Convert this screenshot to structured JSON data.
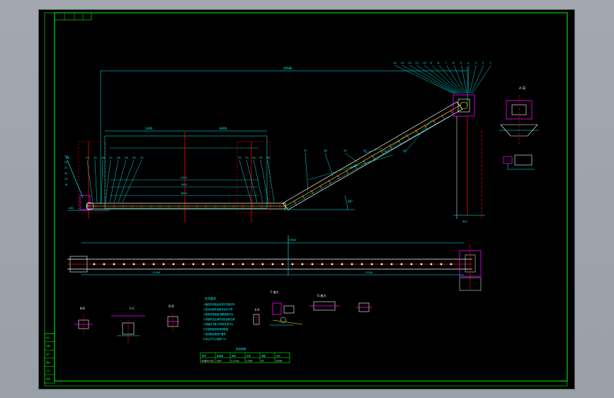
{
  "drawing": {
    "colors": {
      "frame": "#00ff00",
      "dim": "#00ffff",
      "centerline": "#ff0000",
      "conveyor": "#ffffff",
      "highlight": "#ff00ff",
      "hatch": "#ffff00",
      "background": "#000000"
    },
    "balloons_top": [
      "14",
      "13",
      "12",
      "11",
      "10",
      "9",
      "8",
      "7",
      "6",
      "5",
      "4",
      "3",
      "2",
      "1"
    ],
    "balloons_left_stack": [
      "23",
      "22",
      "21",
      "20",
      "19",
      "18"
    ],
    "balloons_mid_left": [
      "24",
      "25",
      "26",
      "27",
      "28",
      "29",
      "30",
      "31"
    ],
    "balloons_mid_right": [
      "32",
      "33",
      "34",
      "35",
      "36"
    ],
    "balloons_incline": [
      "37",
      "38",
      "39",
      "40",
      "41",
      "42"
    ],
    "section_labels": {
      "view_a": "A 向",
      "section_b": "B-B",
      "section_c": "C-C",
      "section_d": "D-D",
      "section_e": "E-E",
      "detail_f": "F 放大",
      "detail_g": "G 放大"
    },
    "tech_title": "技术要求",
    "tech_lines": [
      "1.输送机安装后应进行空载试车",
      "2.各运动部件运转灵活无卡滞",
      "3.链条张紧适度,调整装置可靠",
      "4.减速机加注润滑油至油标位置",
      "5.焊缝应平整,不得有夹渣气孔",
      "6.外露表面涂防锈漆两遍",
      "7.面漆颜色按用户要求",
      "8.未注尺寸公差按IT14"
    ],
    "table_title": "技术参数",
    "table_headers": [
      "型号",
      "输送量",
      "链速",
      "功率",
      "倾角",
      "总长"
    ],
    "table_values": [
      "MS型-B=320",
      "15t/h",
      "0.12m/s",
      "5.5kW",
      "30°",
      "29580"
    ],
    "title_block_rows": [
      "标记",
      "处数",
      "设计",
      "审核",
      "工艺",
      "批准"
    ]
  }
}
